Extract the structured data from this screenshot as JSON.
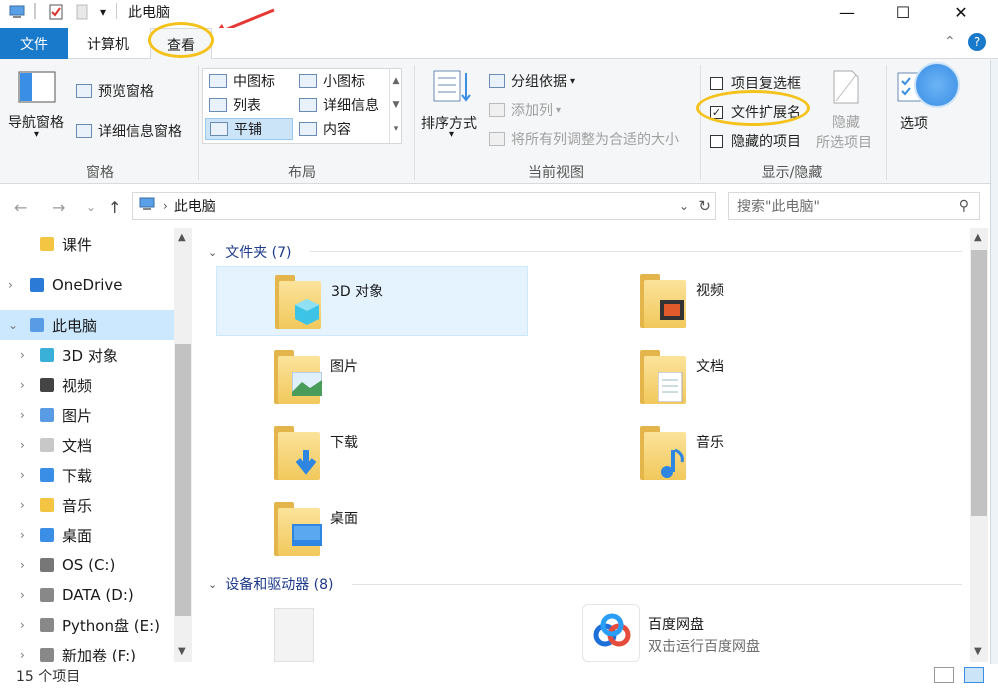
{
  "window": {
    "title": "此电脑",
    "controls": {
      "minimize": "—",
      "maximize": "☐",
      "close": "✕"
    }
  },
  "tabs": {
    "file": "文件",
    "computer": "计算机",
    "view": "查看"
  },
  "ribbon": {
    "pane": {
      "nav_pane": "导航窗格",
      "preview_pane": "预览窗格",
      "details_pane": "详细信息窗格",
      "group": "窗格"
    },
    "layout": {
      "items": [
        "中图标",
        "小图标",
        "列表",
        "详细信息",
        "平铺",
        "内容"
      ],
      "group": "布局"
    },
    "current_view": {
      "sort_by": "排序方式",
      "group_by": "分组依据",
      "add_columns": "添加列",
      "size_all_columns": "将所有列调整为合适的大小",
      "group": "当前视图"
    },
    "show_hide": {
      "item_checkboxes": "项目复选框",
      "file_extensions": "文件扩展名",
      "hidden_items": "隐藏的项目",
      "hide_selected_1": "隐藏",
      "hide_selected_2": "所选项目",
      "group": "显示/隐藏"
    },
    "options": "选项"
  },
  "address": {
    "path": "此电脑",
    "search_placeholder": "搜索\"此电脑\""
  },
  "tree": {
    "items": [
      {
        "label": "课件",
        "level": 1
      },
      {
        "label": "OneDrive",
        "level": 0
      },
      {
        "label": "此电脑",
        "level": 0,
        "selected": true
      },
      {
        "label": "3D 对象",
        "level": 1
      },
      {
        "label": "视频",
        "level": 1
      },
      {
        "label": "图片",
        "level": 1
      },
      {
        "label": "文档",
        "level": 1
      },
      {
        "label": "下载",
        "level": 1
      },
      {
        "label": "音乐",
        "level": 1
      },
      {
        "label": "桌面",
        "level": 1
      },
      {
        "label": "OS (C:)",
        "level": 1
      },
      {
        "label": "DATA (D:)",
        "level": 1
      },
      {
        "label": "Python盘 (E:)",
        "level": 1
      },
      {
        "label": "新加卷 (F:)",
        "level": 1
      }
    ]
  },
  "content": {
    "folders_header": "文件夹 (7)",
    "folders": [
      "3D 对象",
      "视频",
      "图片",
      "文档",
      "下载",
      "音乐",
      "桌面"
    ],
    "devices_header": "设备和驱动器 (8)",
    "devices": [
      {
        "name": "",
        "sub": ""
      },
      {
        "name": "百度网盘",
        "sub": "双击运行百度网盘"
      }
    ]
  },
  "status": {
    "count": "15 个项目"
  },
  "colors": {
    "accent": "#1979ca",
    "highlight_circle": "#f4c21a",
    "arrow": "#e53935"
  }
}
